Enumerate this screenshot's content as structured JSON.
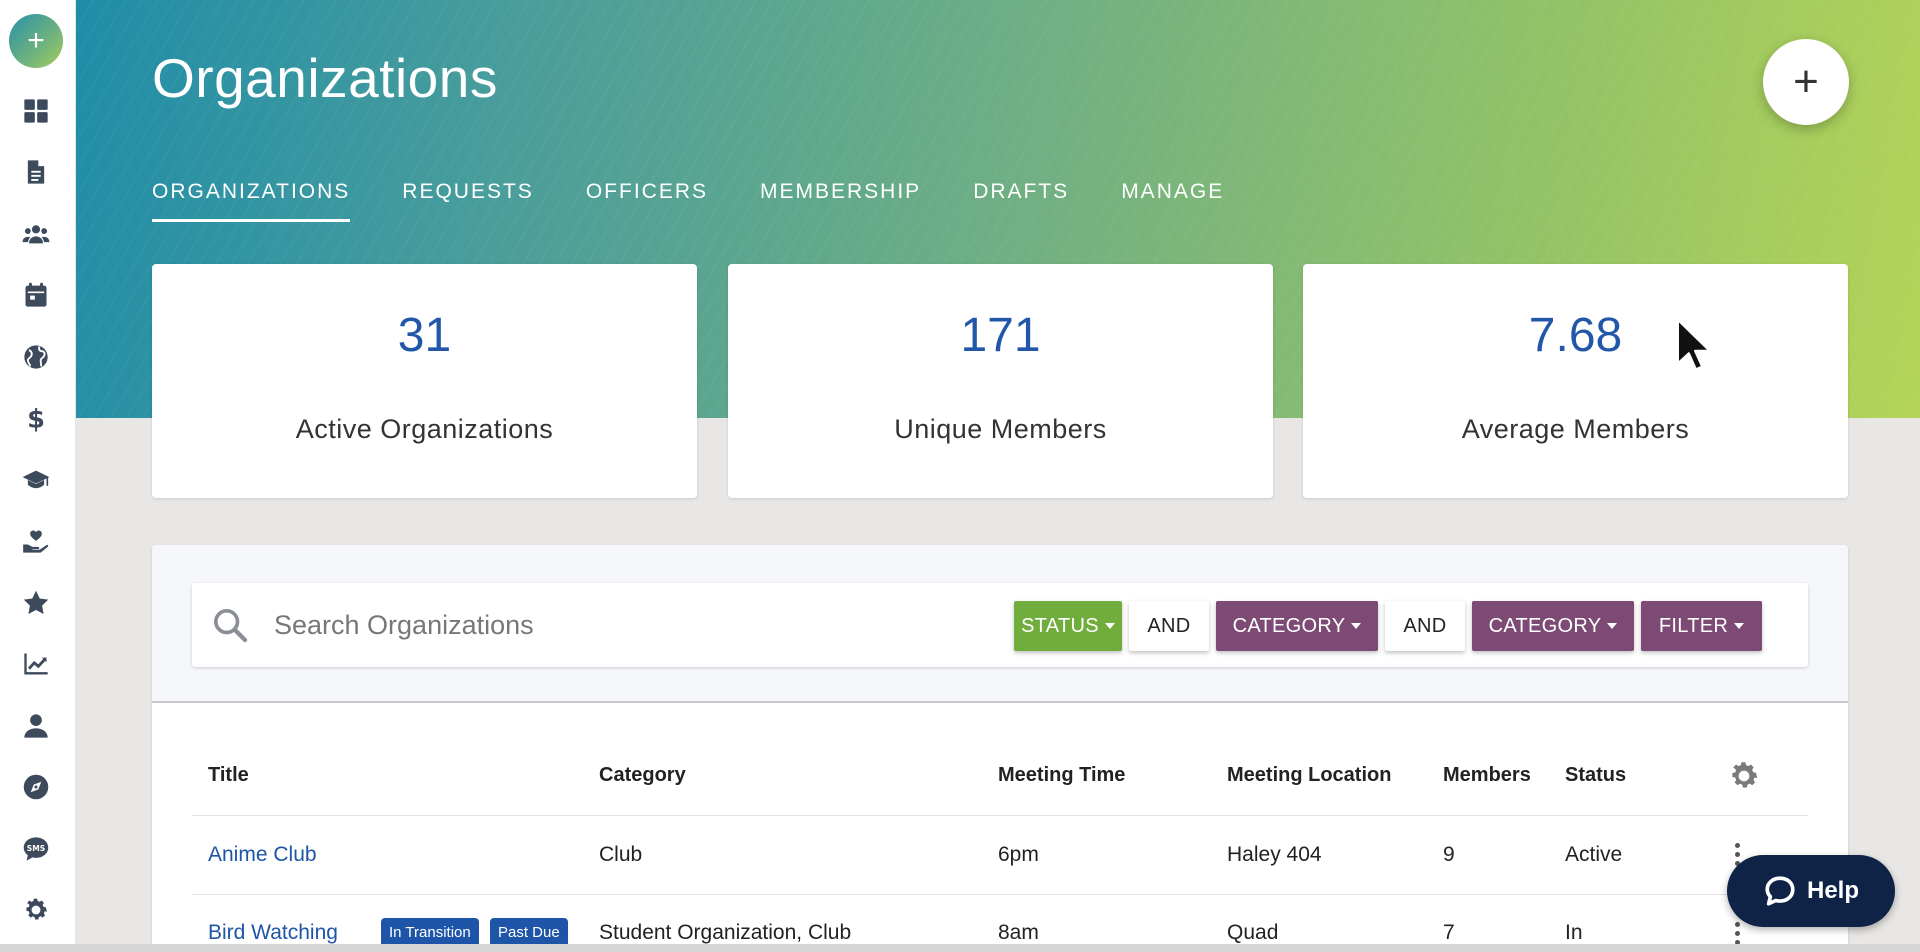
{
  "sidebar": {
    "add_label": "+",
    "items": [
      {
        "icon": "dashboard-icon"
      },
      {
        "icon": "document-icon"
      },
      {
        "icon": "users-icon"
      },
      {
        "icon": "calendar-icon"
      },
      {
        "icon": "globe-icon"
      },
      {
        "icon": "dollar-icon"
      },
      {
        "icon": "graduation-cap-icon"
      },
      {
        "icon": "hand-heart-icon"
      },
      {
        "icon": "star-icon"
      },
      {
        "icon": "chart-line-icon"
      },
      {
        "icon": "user-icon"
      },
      {
        "icon": "compass-icon"
      },
      {
        "icon": "sms-icon"
      },
      {
        "icon": "gear-icon"
      }
    ]
  },
  "header": {
    "title": "Organizations",
    "add_label": "+",
    "tabs": [
      {
        "label": "ORGANIZATIONS",
        "active": true
      },
      {
        "label": "REQUESTS",
        "active": false
      },
      {
        "label": "OFFICERS",
        "active": false
      },
      {
        "label": "MEMBERSHIP",
        "active": false
      },
      {
        "label": "DRAFTS",
        "active": false
      },
      {
        "label": "MANAGE",
        "active": false
      }
    ]
  },
  "stats": [
    {
      "value": "31",
      "label": "Active Organizations"
    },
    {
      "value": "171",
      "label": "Unique Members"
    },
    {
      "value": "7.68",
      "label": "Average Members"
    }
  ],
  "search": {
    "placeholder": "Search Organizations",
    "filters": {
      "status": "STATUS",
      "and1": "AND",
      "category1": "CATEGORY",
      "and2": "AND",
      "category2": "CATEGORY",
      "filter": "FILTER"
    }
  },
  "table": {
    "columns": [
      "Title",
      "Category",
      "Meeting Time",
      "Meeting Location",
      "Members",
      "Status"
    ],
    "rows": [
      {
        "title": "Anime Club",
        "badges": [],
        "category": "Club",
        "time": "6pm",
        "location": "Haley 404",
        "members": "9",
        "status": "Active"
      },
      {
        "title": "Bird Watching",
        "badges": [
          "In Transition",
          "Past Due"
        ],
        "category": "Student Organization, Club",
        "time": "8am",
        "location": "Quad",
        "members": "7",
        "status": "In"
      }
    ]
  },
  "help": {
    "label": "Help"
  },
  "colors": {
    "accent_blue": "#1f55a8",
    "status_green": "#70ad3c",
    "category_purple": "#7c4a74",
    "help_navy": "#0e2346"
  }
}
